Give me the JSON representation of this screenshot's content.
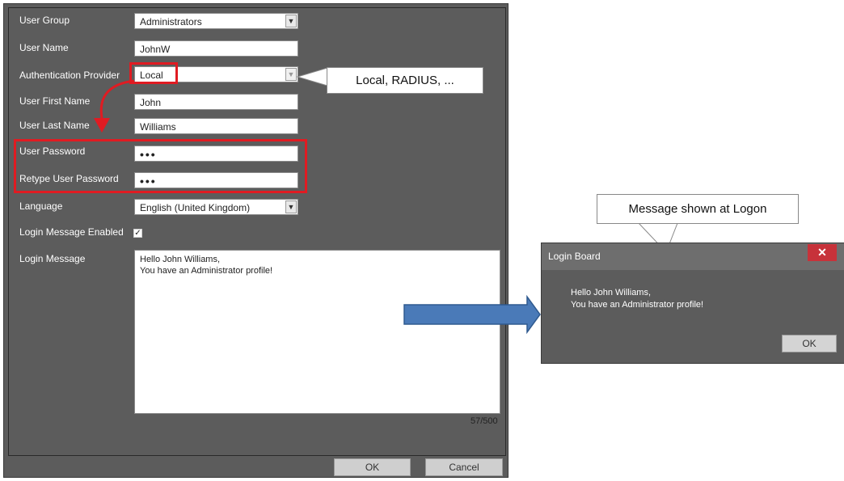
{
  "form": {
    "fields": {
      "user_group": {
        "label": "User Group",
        "value": "Administrators"
      },
      "user_name": {
        "label": "User Name",
        "value": "JohnW"
      },
      "auth_provider": {
        "label": "Authentication Provider",
        "value": "Local"
      },
      "first_name": {
        "label": "User First Name",
        "value": "John"
      },
      "last_name": {
        "label": "User Last Name",
        "value": "Williams"
      },
      "password": {
        "label": "User Password",
        "value": "•••"
      },
      "retype_password": {
        "label": "Retype User Password",
        "value": "•••"
      },
      "language": {
        "label": "Language",
        "value": "English (United Kingdom)"
      },
      "login_msg_enabled": {
        "label": "Login Message Enabled",
        "checked": true
      },
      "login_message": {
        "label": "Login Message",
        "line1": "Hello John Williams,",
        "line2": "You have an Administrator profile!",
        "counter": "57/500"
      }
    },
    "buttons": {
      "ok": "OK",
      "cancel": "Cancel"
    }
  },
  "callouts": {
    "providers": "Local, RADIUS, ...",
    "logon": "Message shown at Logon"
  },
  "login_board": {
    "title": "Login Board",
    "close": "✕",
    "line1": "Hello John Williams,",
    "line2": "You have an Administrator profile!",
    "ok": "OK"
  },
  "colors": {
    "panel": "#5c5c5c",
    "highlight": "#e01b22",
    "close_button": "#c7323a",
    "arrow": "#4a7ab8"
  }
}
